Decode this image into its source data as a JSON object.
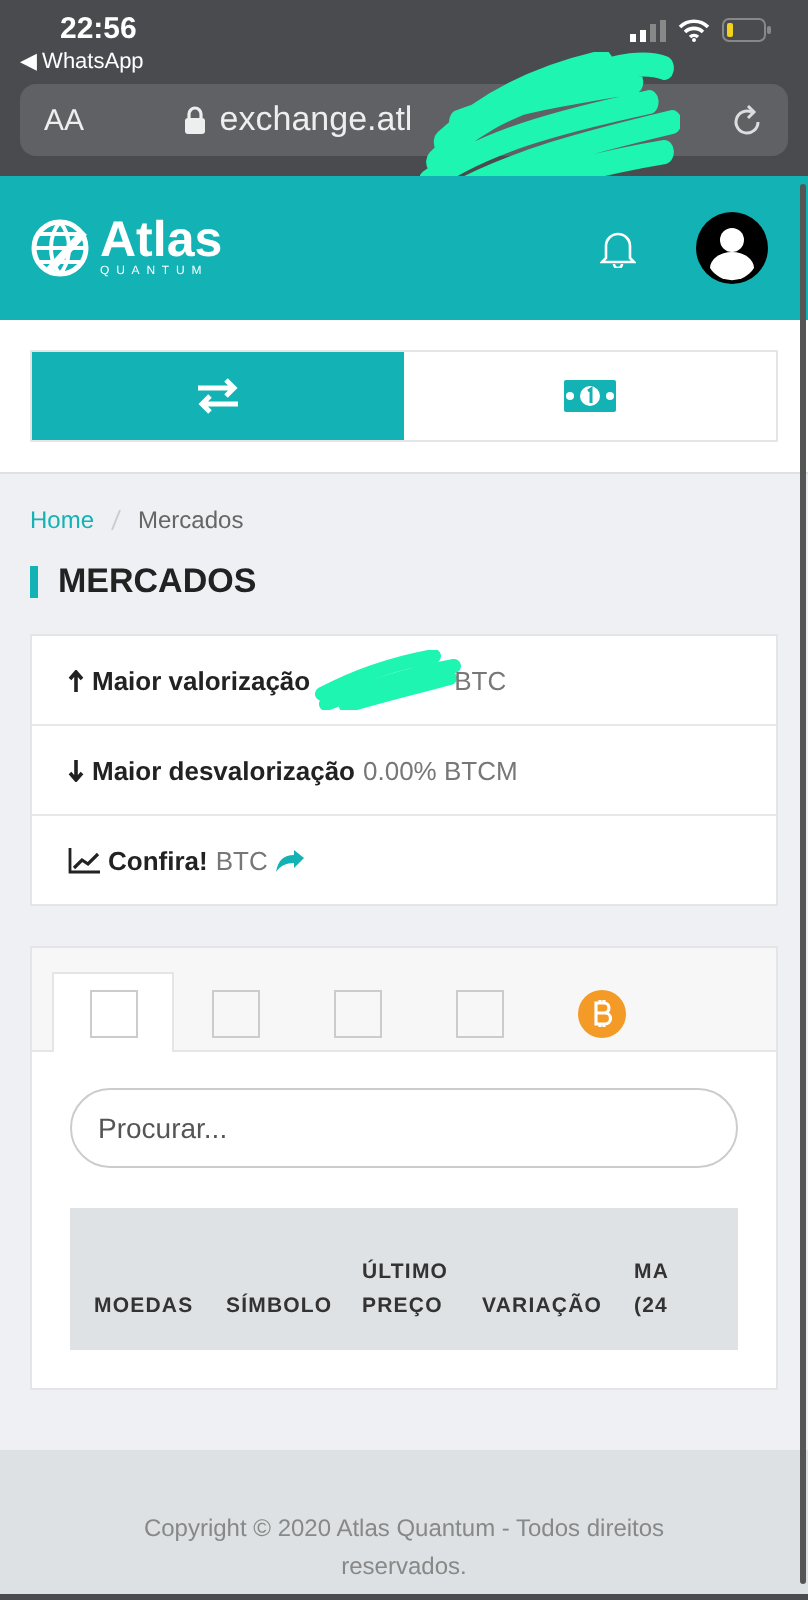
{
  "status_bar": {
    "time": "22:56",
    "back_label": "◀ WhatsApp"
  },
  "browser": {
    "text_size": "AA",
    "url": "exchange.atl"
  },
  "header": {
    "brand": "Atlas",
    "brand_sub": "QUANTUM"
  },
  "toggle": [
    {
      "kind": "exchange",
      "selected": true
    },
    {
      "kind": "money",
      "selected": false
    }
  ],
  "breadcrumb": [
    "Home",
    "Mercados"
  ],
  "page_title": "MERCADOS",
  "stats": [
    {
      "kind": "up",
      "label": "Maior valorização",
      "value": "BTC",
      "redacted": true
    },
    {
      "kind": "down",
      "label": "Maior desvalorização",
      "value": "0.00% BTCM",
      "redacted": false
    },
    {
      "kind": "chart",
      "label": "Confira!",
      "value": "BTC",
      "redacted": false
    }
  ],
  "market_tabs": [
    {
      "kind": "image",
      "selected": true
    },
    {
      "kind": "image",
      "selected": false
    },
    {
      "kind": "image",
      "selected": false
    },
    {
      "kind": "image",
      "selected": false
    },
    {
      "kind": "bitcoin",
      "selected": false
    }
  ],
  "search": {
    "placeholder": "Procurar..."
  },
  "table": {
    "columns": [
      "MOEDAS",
      "SÍMBOLO",
      "ÚLTIMO PREÇO",
      "VARIAÇÃO",
      "MA (24"
    ]
  },
  "footer": "Copyright © 2020 Atlas Quantum - Todos direitos reservados."
}
